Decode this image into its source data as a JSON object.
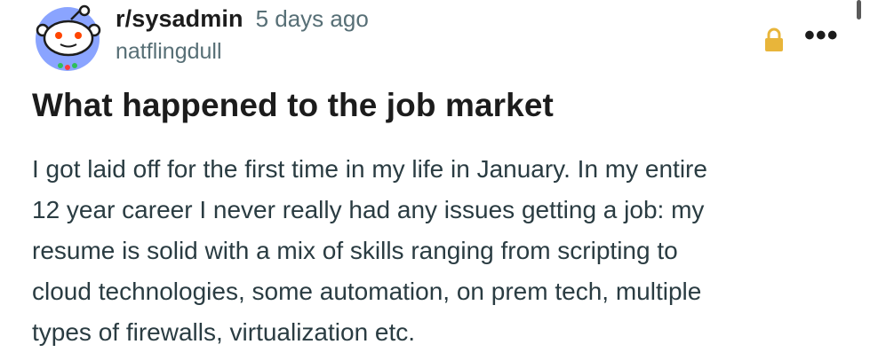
{
  "post": {
    "subreddit": "r/sysadmin",
    "timestamp": "5 days ago",
    "author": "natflingdull",
    "title": "What happened to the job market",
    "body": "I got laid off for the first time in my life in January. In my entire\n12 year career I never really had any issues getting a job: my\nresume is solid with a mix of skills ranging from scripting to\ncloud technologies, some automation, on prem tech, multiple\ntypes of firewalls, virtualization etc."
  },
  "icons": {
    "avatar": "snoo-avatar-icon",
    "lock": "lock-icon",
    "more": "more-options-icon",
    "more_glyph": "•••"
  },
  "colors": {
    "avatar_bg": "#8aa4ff",
    "lock": "#e8b53a",
    "meta_gray": "#576f76",
    "text": "#1c1c1c"
  }
}
